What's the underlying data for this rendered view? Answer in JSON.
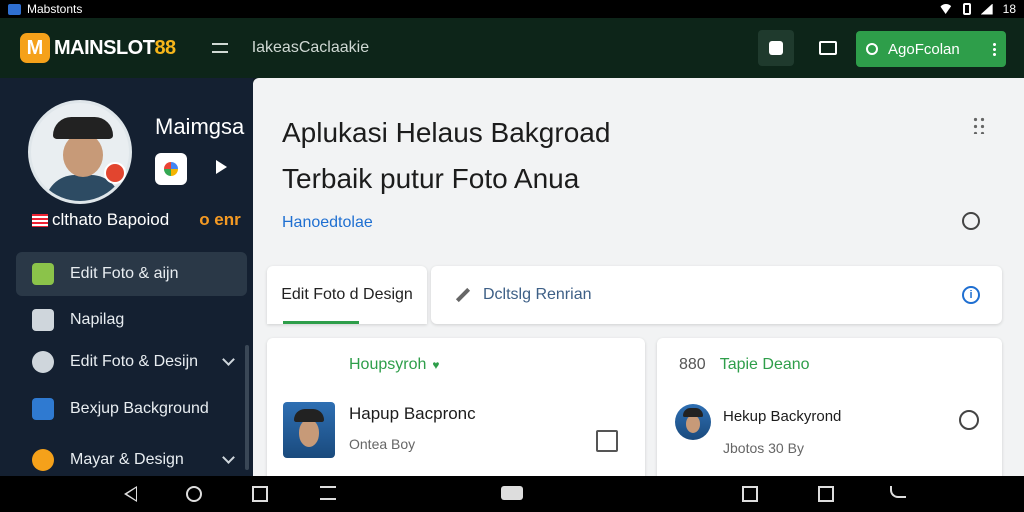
{
  "status_bar": {
    "app_name": "Mabstonts",
    "clock": "18",
    "icons": [
      "wifi-icon",
      "battery-icon",
      "signal-icon"
    ]
  },
  "header": {
    "logo_letter": "M",
    "logo_main": "MAINSLOT",
    "logo_accent": "88",
    "subtitle": "IakeasCaclaakie",
    "search_label": "AgoFcolan",
    "colors": {
      "bg": "#0d2519",
      "accent": "#2e9e4a",
      "logo": "#f5a11a"
    }
  },
  "sidebar": {
    "user_name": "Maimgsa",
    "sub_text": "clthato Bapoiod",
    "sub_warn": "o enr",
    "items": [
      {
        "label": "Edit Foto & aijn",
        "icon": "photo-edit-icon",
        "color": "#8bc34a",
        "active": true,
        "chevron": false
      },
      {
        "label": "Napilag",
        "icon": "window-icon",
        "color": "#cfd6dc",
        "active": false,
        "chevron": false
      },
      {
        "label": "Edit Foto & Desijn",
        "icon": "palette-icon",
        "color": "#cfd6dc",
        "active": false,
        "chevron": true
      },
      {
        "label": "Bexjup Background",
        "icon": "background-icon",
        "color": "#2f7ad1",
        "active": false,
        "chevron": false
      },
      {
        "label": "Mayar & Design",
        "icon": "avatar-design-icon",
        "color": "#f5a11a",
        "active": false,
        "chevron": true
      }
    ]
  },
  "main": {
    "title_line1": "Aplukasi Helaus Bakgroad",
    "title_line2": "Terbaik putur Foto Anua",
    "section_link": "Hanoedtolae",
    "tab_active": "Edit Foto d Design",
    "tab_search": "Dcltslg Renrian",
    "card1": {
      "header": "Houpsyroh",
      "title": "Hapup Bacpronc",
      "meta": "Ontea Boy"
    },
    "card2": {
      "header_num": "880",
      "header": "Tapie Deano",
      "title": "Hekup Backyrond",
      "meta": "Jbotos 30 By"
    }
  }
}
